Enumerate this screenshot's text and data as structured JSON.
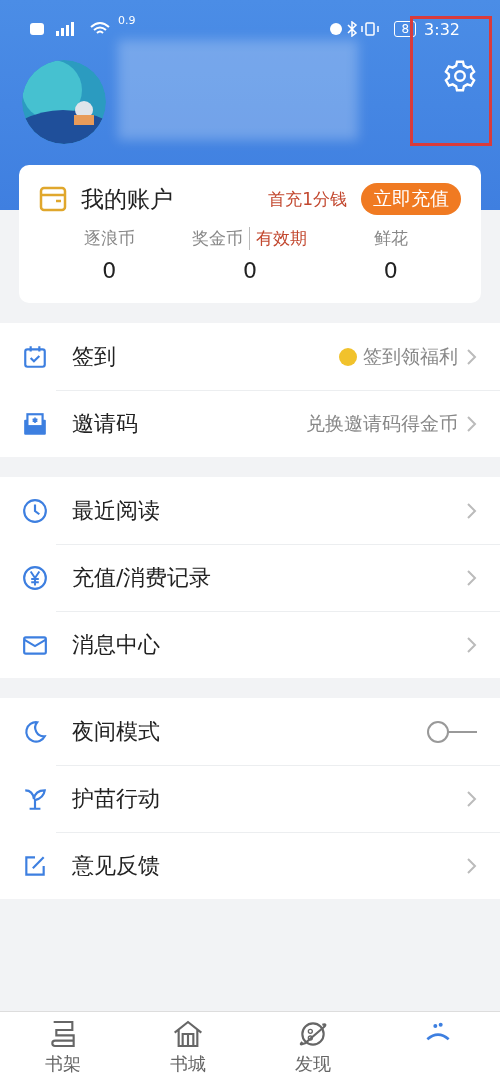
{
  "status_bar": {
    "speed": "0.9",
    "battery": "8",
    "time": "3:32"
  },
  "account": {
    "title": "我的账户",
    "promo": "首充1分钱",
    "button": "立即充值",
    "stats": [
      {
        "label": "逐浪币",
        "value": "0"
      },
      {
        "label": "奖金币",
        "tag": "有效期",
        "value": "0"
      },
      {
        "label": "鲜花",
        "value": "0"
      }
    ]
  },
  "groups": [
    [
      {
        "kind": "checkin",
        "label": "签到",
        "hint": "签到领福利"
      },
      {
        "kind": "invite",
        "label": "邀请码",
        "hint": "兑换邀请码得金币"
      }
    ],
    [
      {
        "kind": "clock",
        "label": "最近阅读"
      },
      {
        "kind": "yuan",
        "label": "充值/消费记录"
      },
      {
        "kind": "mail",
        "label": "消息中心"
      }
    ],
    [
      {
        "kind": "moon",
        "label": "夜间模式",
        "on": false
      },
      {
        "kind": "sprout",
        "label": "护苗行动"
      },
      {
        "kind": "edit",
        "label": "意见反馈"
      }
    ]
  ],
  "tabs": [
    {
      "kind": "shelf",
      "label": "书架",
      "selected": false
    },
    {
      "kind": "store",
      "label": "书城",
      "selected": false
    },
    {
      "kind": "discover",
      "label": "发现",
      "selected": false
    },
    {
      "kind": "me",
      "selected": true
    }
  ]
}
